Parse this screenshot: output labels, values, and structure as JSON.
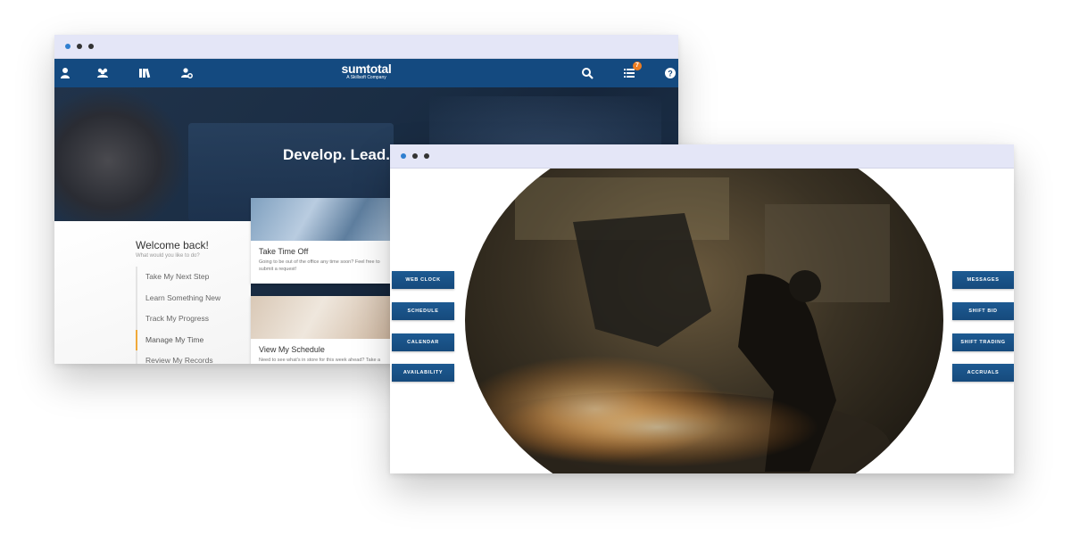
{
  "back_window": {
    "nav": {
      "logo_brand": "sumtotal",
      "logo_tagline": "A Skillsoft Company",
      "badge_count": "7"
    },
    "hero_title": "Develop. Lead.",
    "welcome": {
      "title": "Welcome back!",
      "subtitle": "What would you like to do?"
    },
    "menu": [
      "Take My Next Step",
      "Learn Something New",
      "Track My Progress",
      "Manage My Time",
      "Review My Records"
    ],
    "active_menu_index": 3,
    "cards": [
      {
        "title": "Take Time Off",
        "description": "Going to be out of the office any time soon? Feel free to submit a request!"
      },
      {
        "title": "View My Schedule",
        "description": "Need to see what's in store for this week ahead? Take a"
      }
    ]
  },
  "front_window": {
    "left_buttons": [
      "WEB CLOCK",
      "SCHEDULE",
      "CALENDAR",
      "AVAILABILITY"
    ],
    "right_buttons": [
      "MESSAGES",
      "SHIFT BID",
      "SHIFT TRADING",
      "ACCRUALS"
    ]
  },
  "colors": {
    "nav_bar": "#144a80",
    "title_bar": "#e4e6f7",
    "accent_orange": "#ef7e22",
    "active_menu_border": "#f0a93a",
    "button_blue": "#1d5a92"
  },
  "icons": {
    "nav_left": [
      "person-icon",
      "group-icon",
      "books-icon",
      "user-gear-icon"
    ],
    "nav_right": [
      "search-icon",
      "task-list-icon",
      "help-icon"
    ]
  }
}
